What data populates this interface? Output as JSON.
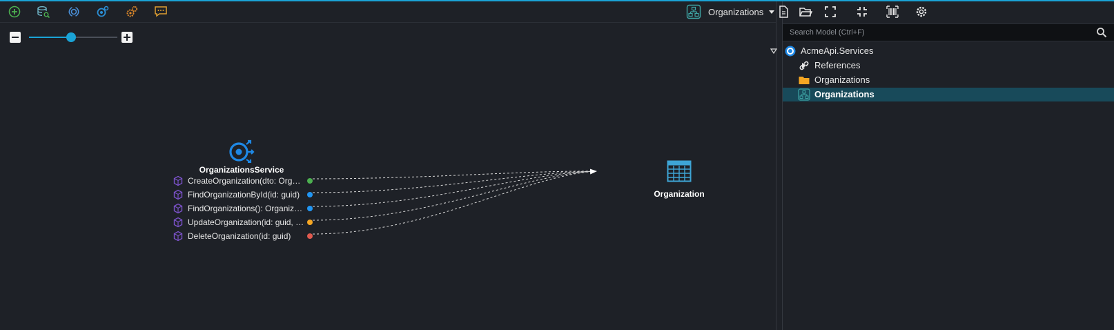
{
  "designer": {
    "toolbar": {
      "buttons": [
        {
          "name": "add-element",
          "icon": "add-icon"
        },
        {
          "name": "add-database",
          "icon": "database-search-icon"
        },
        {
          "name": "add-service",
          "icon": "service-cycle-icon"
        },
        {
          "name": "add-service-operation",
          "icon": "service-gear-icon"
        },
        {
          "name": "settings",
          "icon": "gear-cluster-icon"
        },
        {
          "name": "add-comment",
          "icon": "comment-icon"
        }
      ]
    },
    "diagram_selector": {
      "label": "Organizations",
      "icon": "diagram-hierarchy-icon"
    },
    "zoom": {
      "level": 0.48
    },
    "service": {
      "title": "OrganizationsService",
      "icon": "service-icon",
      "operations": [
        {
          "label": "CreateOrganization(dto: OrganizationCreateDto)",
          "dot_color": "#4caf50"
        },
        {
          "label": "FindOrganizationById(id: guid)",
          "dot_color": "#2196f3"
        },
        {
          "label": "FindOrganizations(): Organization[]",
          "dot_color": "#2196f3"
        },
        {
          "label": "UpdateOrganization(id: guid, dto)",
          "dot_color": "#f5a623"
        },
        {
          "label": "DeleteOrganization(id: guid)",
          "dot_color": "#e05a4f"
        }
      ]
    },
    "entity": {
      "title": "Organization",
      "icon": "entity-table-icon"
    }
  },
  "explorer": {
    "toolbar": {
      "buttons": [
        {
          "name": "new-file",
          "icon": "file-icon"
        },
        {
          "name": "open-folder",
          "icon": "folder-open-icon"
        },
        {
          "name": "expand-all",
          "icon": "expand-icon"
        },
        {
          "name": "collapse-all",
          "icon": "collapse-icon"
        },
        {
          "name": "barcode",
          "icon": "barcode-icon"
        },
        {
          "name": "settings",
          "icon": "gear-icon"
        }
      ]
    },
    "search": {
      "placeholder": "Search Model (Ctrl+F)",
      "value": ""
    },
    "tree": [
      {
        "label": "AcmeApi.Services",
        "icon": "package-icon",
        "expanded": true,
        "level": 0,
        "toggle": "expanded"
      },
      {
        "label": "References",
        "icon": "link-icon",
        "level": 1,
        "toggle": "collapsed"
      },
      {
        "label": "Organizations",
        "icon": "folder-icon",
        "level": 1,
        "toggle": "collapsed"
      },
      {
        "label": "Organizations",
        "icon": "diagram-hierarchy-icon",
        "level": 1,
        "toggle": "none",
        "selected": true
      }
    ]
  },
  "colors": {
    "accent": "#1aa3d6",
    "background": "#1e2127",
    "selection": "#184a5a",
    "service_blue": "#1e88e5",
    "operation_purple": "#7b52c9",
    "entity_blue": "#3ea5d6",
    "folder_orange": "#f5a623"
  }
}
